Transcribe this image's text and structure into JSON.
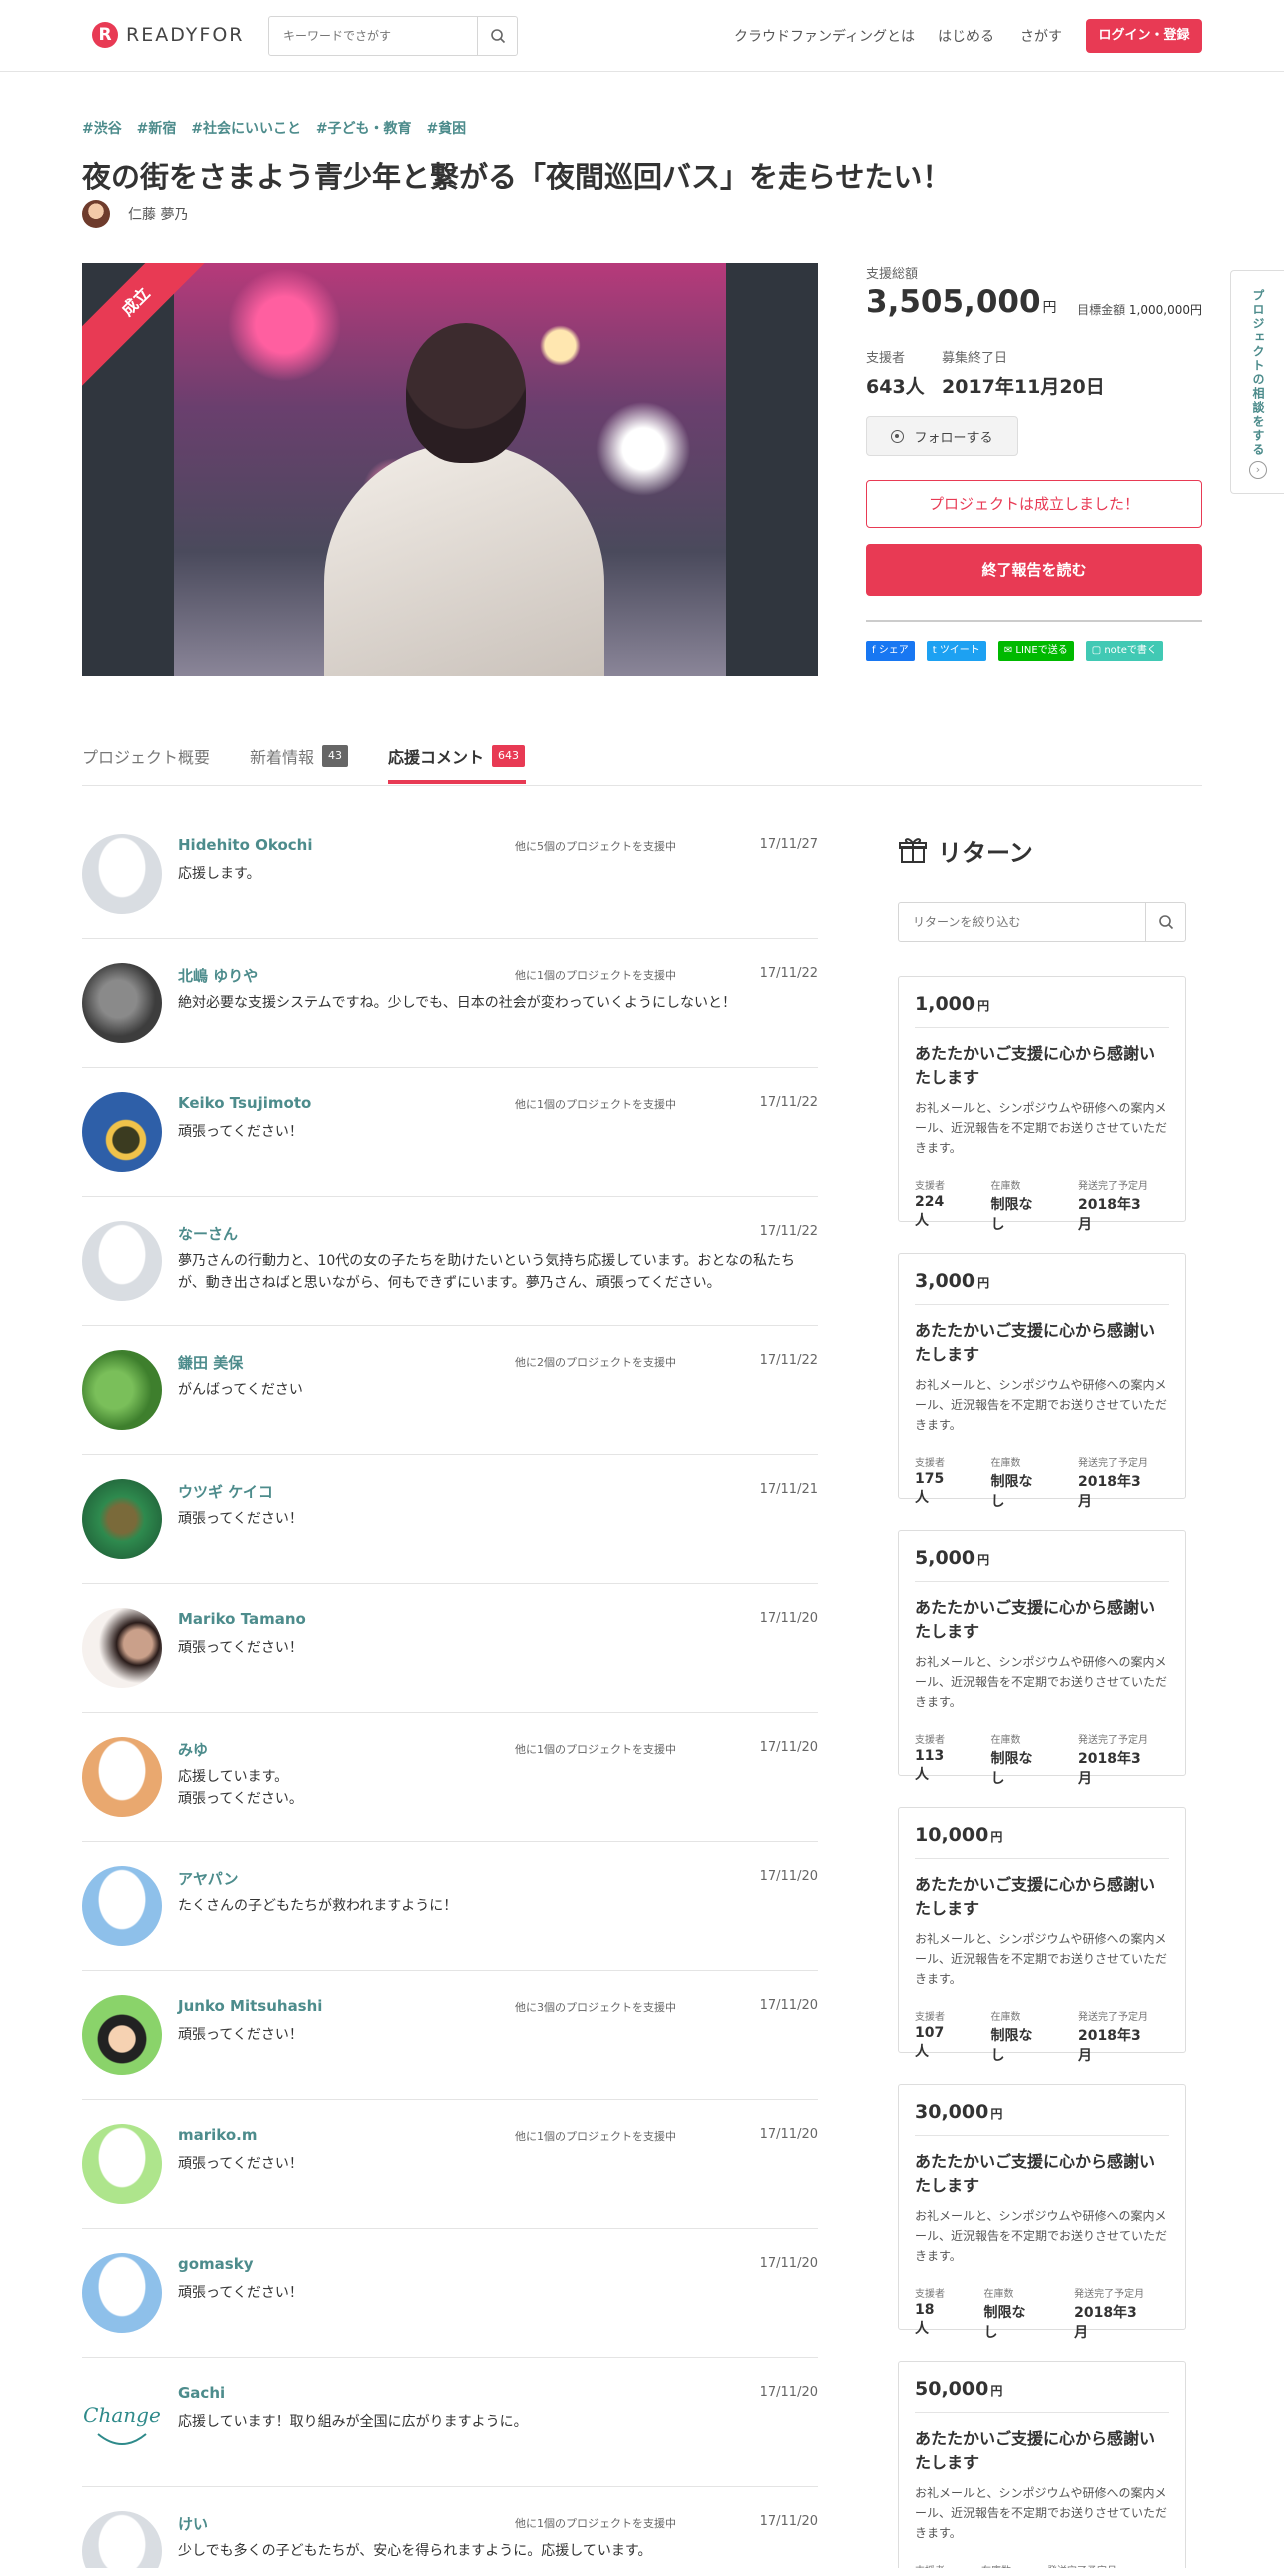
{
  "header": {
    "logo_text": "READYFOR",
    "search_placeholder": "キーワードでさがす",
    "nav": [
      "クラウドファンディングとは",
      "はじめる",
      "さがす"
    ],
    "login_label": "ログイン・登録"
  },
  "project": {
    "tags": [
      "#渋谷",
      "#新宿",
      "#社会にいいこと",
      "#子ども・教育",
      "#貧困"
    ],
    "title": "夜の街をさまよう青少年と繋がる「夜間巡回バス」を走らせたい！",
    "owner": "仁藤 夢乃",
    "ribbon": "成立"
  },
  "stats": {
    "total_label": "支援総額",
    "total_amount": "3,505,000",
    "yen": "円",
    "goal_label": "目標金額",
    "goal_amount": "1,000,000円",
    "backers_label": "支援者",
    "backers": "643人",
    "end_label": "募集終了日",
    "end_date": "2017年11月20日",
    "follow_label": "フォローする",
    "success_label": "プロジェクトは成立しました！",
    "report_label": "終了報告を読む",
    "share": [
      {
        "label": "シェア",
        "color": "#1877f2"
      },
      {
        "label": "ツイート",
        "color": "#1da1f2"
      },
      {
        "label": "LINEで送る",
        "color": "#00b900"
      },
      {
        "label": "noteで書く",
        "color": "#41c9b4"
      }
    ]
  },
  "side_tab": {
    "label": "プロジェクトの相談をする",
    "icon": "›"
  },
  "tabs": [
    {
      "label": "プロジェクト概要",
      "badge": ""
    },
    {
      "label": "新着情報",
      "badge": "43"
    },
    {
      "label": "応援コメント",
      "badge": "643"
    }
  ],
  "comments": [
    {
      "name": "Hidehito Okochi",
      "meta": "他に5個のプロジェクトを支援中",
      "date": "17/11/27",
      "text": "応援します。",
      "avatar": "default-gray"
    },
    {
      "name": "北嶋 ゆりや",
      "meta": "他に1個のプロジェクトを支援中",
      "date": "17/11/22",
      "text": "絶対必要な支援システムですね。少しでも、日本の社会が変わっていくようにしないと！",
      "avatar": "photo-cat"
    },
    {
      "name": "Keiko Tsujimoto",
      "meta": "他に1個のプロジェクトを支援中",
      "date": "17/11/22",
      "text": "頑張ってください！",
      "avatar": "photo-sunflower"
    },
    {
      "name": "なーさん",
      "meta": "",
      "date": "17/11/22",
      "text": "夢乃さんの行動力と、10代の女の子たちを助けたいという気持ち応援しています。おとなの私たちが、動き出さねばと思いながら、何もできずにいます。夢乃さん、頑張ってください。",
      "avatar": "default-gray"
    },
    {
      "name": "鎌田 美保",
      "meta": "他に2個のプロジェクトを支援中",
      "date": "17/11/22",
      "text": "がんばってください",
      "avatar": "photo-green"
    },
    {
      "name": "ウツギ ケイコ",
      "meta": "",
      "date": "17/11/21",
      "text": "頑張ってください！",
      "avatar": "photo-frog"
    },
    {
      "name": "Mariko Tamano",
      "meta": "",
      "date": "17/11/20",
      "text": "頑張ってください！",
      "avatar": "photo-woman"
    },
    {
      "name": "みゆ",
      "meta": "他に1個のプロジェクトを支援中",
      "date": "17/11/20",
      "text": "応援しています。\n頑張ってください。",
      "avatar": "default-orange"
    },
    {
      "name": "アヤパン",
      "meta": "",
      "date": "17/11/20",
      "text": "たくさんの子どもたちが救われますように！",
      "avatar": "default-blue"
    },
    {
      "name": "Junko Mitsuhashi",
      "meta": "他に3個のプロジェクトを支援中",
      "date": "17/11/20",
      "text": "頑張ってください！",
      "avatar": "photo-cartoon"
    },
    {
      "name": "mariko.m",
      "meta": "他に1個のプロジェクトを支援中",
      "date": "17/11/20",
      "text": "頑張ってください！",
      "avatar": "default-green"
    },
    {
      "name": "gomasky",
      "meta": "",
      "date": "17/11/20",
      "text": "頑張ってください！",
      "avatar": "default-blue"
    },
    {
      "name": "Gachi",
      "meta": "",
      "date": "17/11/20",
      "text": "応援しています！取り組みが全国に広がりますように。",
      "avatar": "logo-change"
    },
    {
      "name": "けい",
      "meta": "他に1個のプロジェクトを支援中",
      "date": "17/11/20",
      "text": "少しでも多くの子どもたちが、安心を得られますように。応援しています。",
      "avatar": "default-gray"
    }
  ],
  "returns": {
    "title": "リターン",
    "search_placeholder": "リターンを絞り込む",
    "stat_labels": {
      "backers": "支援者",
      "stock": "在庫数",
      "delivery": "発送完了予定月"
    },
    "items": [
      {
        "price": "1,000",
        "yen": "円",
        "title": "あたたかいご支援に心から感謝いたします",
        "desc": "お礼メールと、シンポジウムや研修への案内メール、近況報告を不定期でお送りさせていただきます。",
        "backers": "224人",
        "stock": "制限なし",
        "delivery": "2018年3月"
      },
      {
        "price": "3,000",
        "yen": "円",
        "title": "あたたかいご支援に心から感謝いたします",
        "desc": "お礼メールと、シンポジウムや研修への案内メール、近況報告を不定期でお送りさせていただきます。",
        "backers": "175人",
        "stock": "制限なし",
        "delivery": "2018年3月"
      },
      {
        "price": "5,000",
        "yen": "円",
        "title": "あたたかいご支援に心から感謝いたします",
        "desc": "お礼メールと、シンポジウムや研修への案内メール、近況報告を不定期でお送りさせていただきます。",
        "backers": "113人",
        "stock": "制限なし",
        "delivery": "2018年3月"
      },
      {
        "price": "10,000",
        "yen": "円",
        "title": "あたたかいご支援に心から感謝いたします",
        "desc": "お礼メールと、シンポジウムや研修への案内メール、近況報告を不定期でお送りさせていただきます。",
        "backers": "107人",
        "stock": "制限なし",
        "delivery": "2018年3月"
      },
      {
        "price": "30,000",
        "yen": "円",
        "title": "あたたかいご支援に心から感謝いたします",
        "desc": "お礼メールと、シンポジウムや研修への案内メール、近況報告を不定期でお送りさせていただきます。",
        "backers": "18人",
        "stock": "制限なし",
        "delivery": "2018年3月"
      },
      {
        "price": "50,000",
        "yen": "円",
        "title": "あたたかいご支援に心から感謝いたします",
        "desc": "お礼メールと、シンポジウムや研修への案内メール、近況報告を不定期でお送りさせていただきます。",
        "backers": "",
        "stock": "",
        "delivery": ""
      }
    ]
  }
}
